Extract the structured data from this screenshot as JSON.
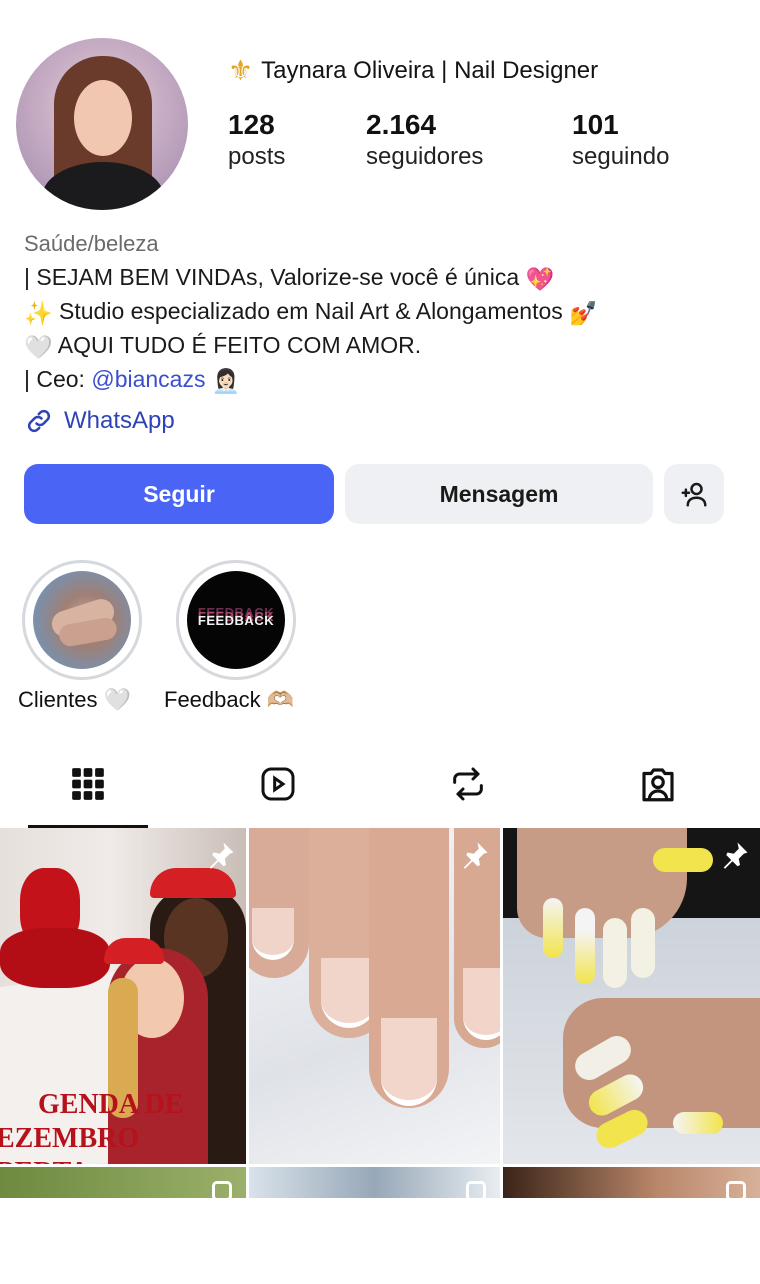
{
  "profile": {
    "name": "Taynara Oliveira | Nail Designer",
    "name_icon": "fleur-de-lis-icon",
    "stats": [
      {
        "value": "128",
        "label": "posts"
      },
      {
        "value": "2.164",
        "label": "seguidores"
      },
      {
        "value": "101",
        "label": "seguindo"
      }
    ],
    "category": "Saúde/beleza",
    "bio": {
      "line1": "| SEJAM BEM VINDAs, Valorize-se você é única",
      "line1_emoji": "💖",
      "line2_emoji_start": "✨",
      "line2": "Studio especializado em Nail Art & Alongamentos",
      "line2_emoji_end": "💅",
      "line3_emoji_start": "🤍",
      "line3": "AQUI TUDO É FEITO COM AMOR.",
      "line4_prefix": "| Ceo: ",
      "line4_mention": "@biancazs",
      "line4_emoji": "👩🏻‍💼"
    },
    "link_label": "WhatsApp"
  },
  "actions": {
    "follow": "Seguir",
    "message": "Mensagem",
    "add_user_icon": "add-user-icon"
  },
  "highlights": [
    {
      "label": "Clientes 🤍",
      "cover": "hands-photo"
    },
    {
      "label": "Feedback 🫶🏼",
      "cover_text": "FEEDBACK"
    }
  ],
  "tabs": [
    "grid-icon",
    "reels-icon",
    "repost-icon",
    "tagged-icon"
  ],
  "posts": [
    {
      "overlay_text": "GENDA DE\nEZEMBRO\nBERTA",
      "pinned": true
    },
    {
      "pinned": true
    },
    {
      "pinned": true
    }
  ],
  "colors": {
    "accent": "#4a65f6",
    "link": "#2f43b8",
    "secondary_button": "#eef0f3"
  }
}
